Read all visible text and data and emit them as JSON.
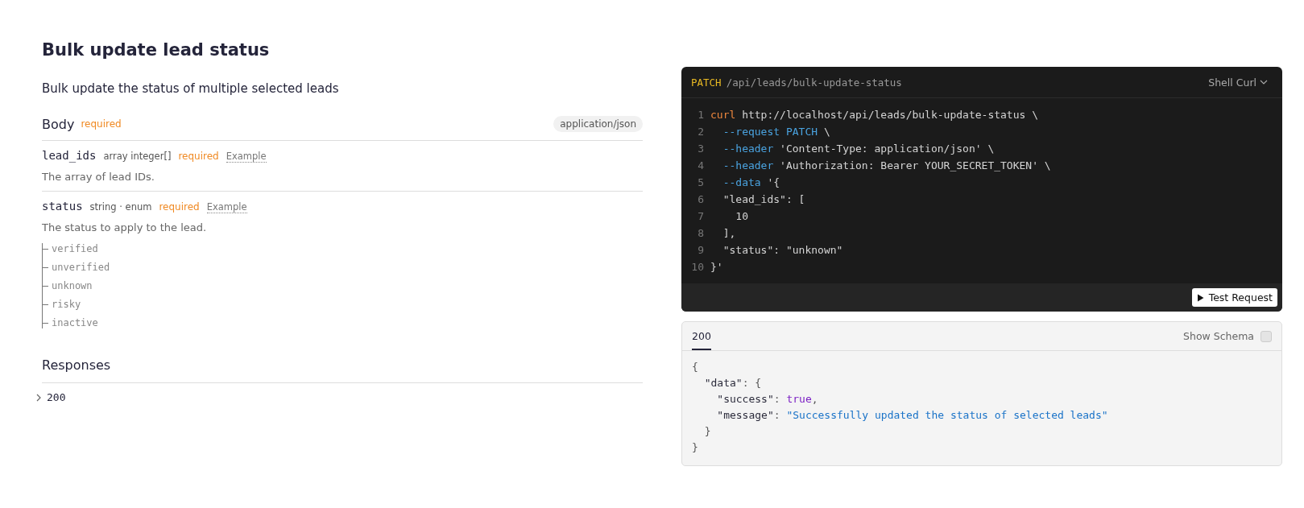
{
  "title": "Bulk update lead status",
  "description": "Bulk update the status of multiple selected leads",
  "body": {
    "label": "Body",
    "required": "required",
    "content_type": "application/json",
    "params": [
      {
        "name": "lead_ids",
        "type": "array integer[]",
        "required": "required",
        "example": "Example",
        "description": "The array of lead IDs."
      },
      {
        "name": "status",
        "type": "string · enum",
        "required": "required",
        "example": "Example",
        "description": "The status to apply to the lead.",
        "enum": [
          "verified",
          "unverified",
          "unknown",
          "risky",
          "inactive"
        ]
      }
    ]
  },
  "responses": {
    "label": "Responses",
    "items": [
      {
        "code": "200",
        "expanded": false
      }
    ]
  },
  "request": {
    "method": "PATCH",
    "path": "/api/leads/bulk-update-status",
    "language": "Shell Curl",
    "lines": [
      {
        "number": "1",
        "tokens": [
          {
            "text": "curl",
            "kind": "command"
          },
          {
            "text": " http://localhost/api/leads/bulk-update-status \\",
            "kind": "plain"
          }
        ]
      },
      {
        "number": "2",
        "tokens": [
          {
            "text": "  --request PATCH",
            "kind": "flag"
          },
          {
            "text": " \\",
            "kind": "plain"
          }
        ]
      },
      {
        "number": "3",
        "tokens": [
          {
            "text": "  --header",
            "kind": "flag"
          },
          {
            "text": " 'Content-Type: application/json' \\",
            "kind": "plain"
          }
        ]
      },
      {
        "number": "4",
        "tokens": [
          {
            "text": "  --header",
            "kind": "flag"
          },
          {
            "text": " 'Authorization: Bearer YOUR_SECRET_TOKEN' \\",
            "kind": "plain"
          }
        ]
      },
      {
        "number": "5",
        "tokens": [
          {
            "text": "  --data",
            "kind": "flag"
          },
          {
            "text": " '{",
            "kind": "plain"
          }
        ]
      },
      {
        "number": "6",
        "tokens": [
          {
            "text": "  \"lead_ids\": [",
            "kind": "plain"
          }
        ]
      },
      {
        "number": "7",
        "tokens": [
          {
            "text": "    10",
            "kind": "plain"
          }
        ]
      },
      {
        "number": "8",
        "tokens": [
          {
            "text": "  ],",
            "kind": "plain"
          }
        ]
      },
      {
        "number": "9",
        "tokens": [
          {
            "text": "  \"status\": \"unknown\"",
            "kind": "plain"
          }
        ]
      },
      {
        "number": "10",
        "tokens": [
          {
            "text": "}'",
            "kind": "plain"
          }
        ]
      }
    ],
    "button": "Test Request"
  },
  "response_example": {
    "tabs": [
      {
        "label": "200",
        "selected": true
      }
    ],
    "schema_label": "Show Schema",
    "schema_checked": false,
    "lines": [
      [
        {
          "text": "{",
          "kind": "punct"
        }
      ],
      [
        {
          "text": "  \"data\"",
          "kind": "key"
        },
        {
          "text": ": {",
          "kind": "punct"
        }
      ],
      [
        {
          "text": "    \"success\"",
          "kind": "key"
        },
        {
          "text": ": ",
          "kind": "punct"
        },
        {
          "text": "true",
          "kind": "bool"
        },
        {
          "text": ",",
          "kind": "punct"
        }
      ],
      [
        {
          "text": "    \"message\"",
          "kind": "key"
        },
        {
          "text": ": ",
          "kind": "punct"
        },
        {
          "text": "\"Successfully updated the status of selected leads\"",
          "kind": "string"
        }
      ],
      [
        {
          "text": "  }",
          "kind": "punct"
        }
      ],
      [
        {
          "text": "}",
          "kind": "punct"
        }
      ]
    ]
  }
}
